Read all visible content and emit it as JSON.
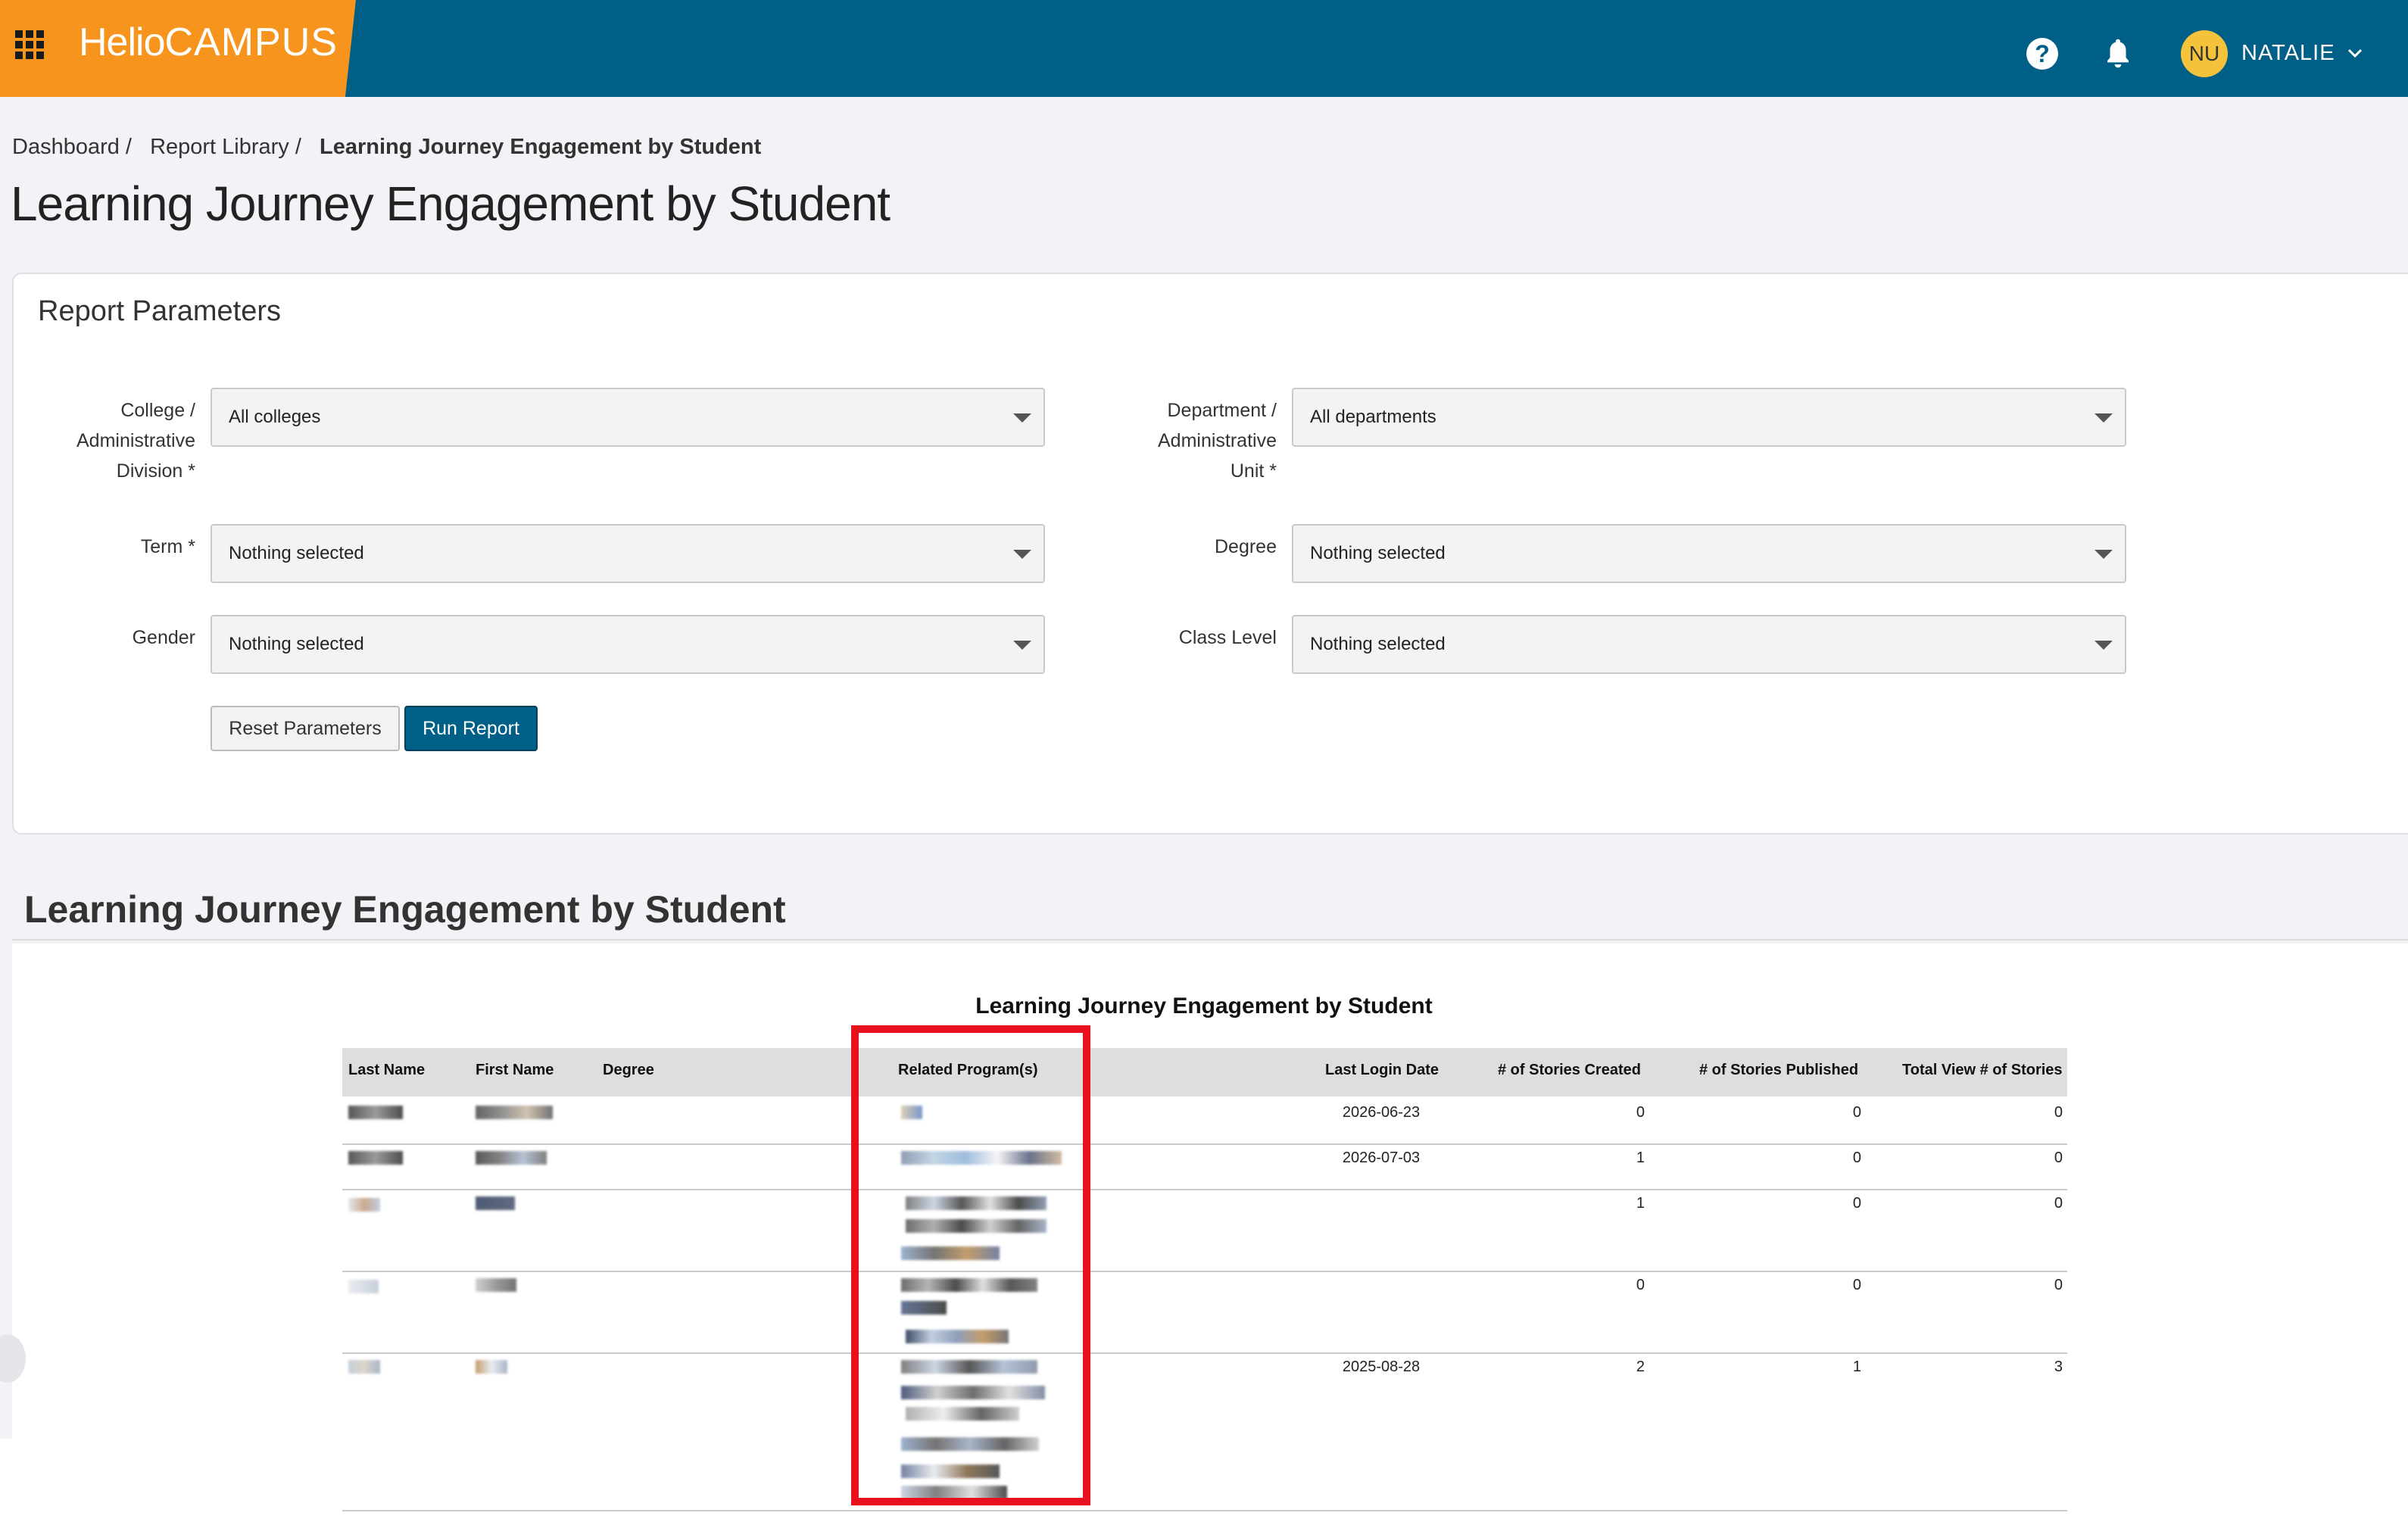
{
  "topbar": {
    "brand_helio": "Helio",
    "brand_campus": "CAMPUS",
    "help_glyph": "?",
    "avatar_initials": "NU",
    "user_name": "NATALIE"
  },
  "breadcrumb": {
    "items": [
      "Dashboard /",
      "Report Library /"
    ],
    "current": "Learning Journey Engagement by Student"
  },
  "page_title": "Learning Journey Engagement by Student",
  "parameters": {
    "title": "Report Parameters",
    "college_label": "College / Administrative Division *",
    "college_value": "All colleges",
    "department_label": "Department / Administrative Unit *",
    "department_value": "All departments",
    "term_label": "Term *",
    "term_value": "Nothing selected",
    "degree_label": "Degree",
    "degree_value": "Nothing selected",
    "gender_label": "Gender",
    "gender_value": "Nothing selected",
    "class_level_label": "Class Level",
    "class_level_value": "Nothing selected",
    "reset_label": "Reset Parameters",
    "run_label": "Run Report"
  },
  "report": {
    "section_title": "Learning Journey Engagement by Student",
    "title": "Learning Journey Engagement by Student",
    "columns": [
      "Last Name",
      "First Name",
      "Degree",
      "Related Program(s)",
      "Last Login Date",
      "# of Stories Created",
      "# of Stories Published",
      "Total View # of Stories"
    ],
    "rows": [
      {
        "last_login": "2026-06-23",
        "created": "0",
        "published": "0",
        "views": "0"
      },
      {
        "last_login": "2026-07-03",
        "created": "1",
        "published": "0",
        "views": "0"
      },
      {
        "last_login": "",
        "created": "1",
        "published": "0",
        "views": "0"
      },
      {
        "last_login": "",
        "created": "0",
        "published": "0",
        "views": "0"
      },
      {
        "last_login": "2025-08-28",
        "created": "2",
        "published": "1",
        "views": "3"
      }
    ]
  },
  "colors": {
    "topbar": "#005f87",
    "brand": "#f7941d",
    "avatar": "#f5c33b",
    "primary_button": "#005f87",
    "highlight": "#e8101c"
  }
}
